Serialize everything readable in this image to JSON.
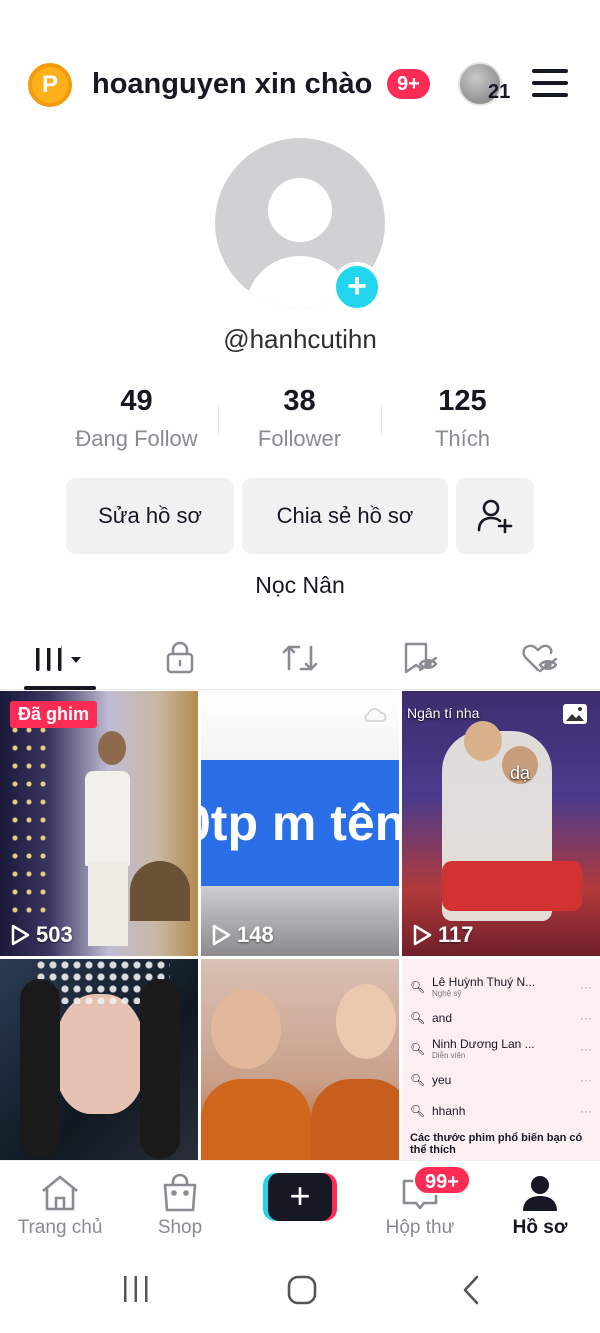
{
  "header": {
    "coin_letter": "P",
    "title": "hoanguyen xin chào",
    "notif_badge": "9+",
    "avatar_count": "21"
  },
  "profile": {
    "handle": "@hanhcutihn",
    "bio": "Nọc Nân"
  },
  "stats": [
    {
      "value": "49",
      "label": "Đang Follow"
    },
    {
      "value": "38",
      "label": "Follower"
    },
    {
      "value": "125",
      "label": "Thích"
    }
  ],
  "buttons": {
    "edit_profile": "Sửa hồ sơ",
    "share_profile": "Chia sẻ hồ sơ"
  },
  "tabs": [
    "videos-grid-icon",
    "lock-icon",
    "repost-icon",
    "favorites-icon",
    "liked-icon"
  ],
  "videos": [
    {
      "views": "503",
      "pinned_label": "Đã ghim"
    },
    {
      "views": "148",
      "text": "0tp m tên"
    },
    {
      "views": "117",
      "caption": "Ngân tí nha",
      "sticker": "dạ"
    },
    {
      "views": ""
    },
    {
      "views": ""
    },
    {
      "views": ""
    }
  ],
  "search_screenshot": {
    "rows": [
      {
        "text": "Lê Huỳnh Thuý N...",
        "sub": "Nghệ sỹ"
      },
      {
        "text": "and",
        "sub": ""
      },
      {
        "text": "Ninh Dương Lan ...",
        "sub": "Diễn viên"
      },
      {
        "text": "yeu",
        "sub": ""
      },
      {
        "text": "hhanh",
        "sub": ""
      }
    ],
    "footer": "Các thước phim phổ biến bạn có thể thích"
  },
  "bottom_nav": {
    "home": "Trang chủ",
    "shop": "Shop",
    "inbox": "Hộp thư",
    "inbox_badge": "99+",
    "profile": "Hồ sơ"
  },
  "colors": {
    "accent_red": "#fe2c55",
    "accent_cyan": "#20d5ec",
    "text_primary": "#161823",
    "text_secondary": "#8a8b91"
  }
}
